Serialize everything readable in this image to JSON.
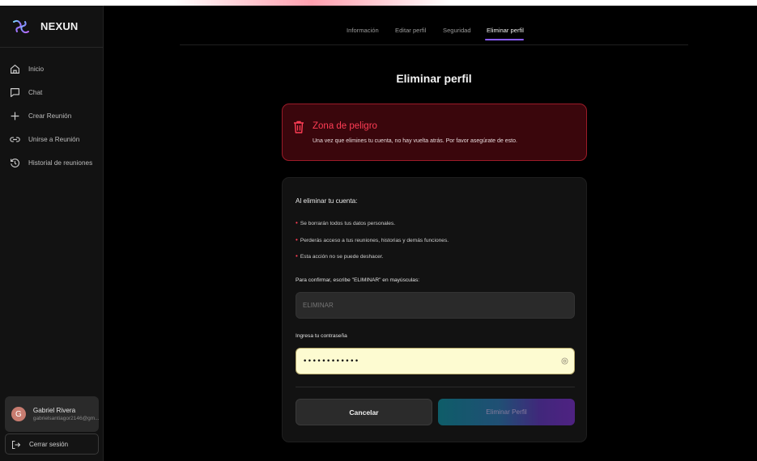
{
  "app": {
    "brand": "NEXUN"
  },
  "sidebar": {
    "items": [
      {
        "label": "Inicio",
        "icon": "home-icon"
      },
      {
        "label": "Chat",
        "icon": "chat-icon"
      },
      {
        "label": "Crear Reunión",
        "icon": "plus-icon"
      },
      {
        "label": "Unirse a Reunión",
        "icon": "link-icon"
      },
      {
        "label": "Historial de reuniones",
        "icon": "history-icon"
      }
    ]
  },
  "user": {
    "initial": "G",
    "name": "Gabriel Rivera",
    "email": "gabrielsantiagor2146@gm..."
  },
  "logout": {
    "label": "Cerrar sesión"
  },
  "tabs": [
    {
      "label": "Información"
    },
    {
      "label": "Editar perfil"
    },
    {
      "label": "Seguridad"
    },
    {
      "label": "Eliminar perfil",
      "active": true
    }
  ],
  "page": {
    "title": "Eliminar perfil"
  },
  "danger": {
    "title": "Zona de peligro",
    "text": "Una vez que elimines tu cuenta, no hay vuelta atrás. Por favor asegúrate de esto.",
    "color": "#ff3d55"
  },
  "form": {
    "heading": "Al eliminar tu cuenta:",
    "bullets": [
      "Se borrarán todos tus datos personales.",
      "Perderás acceso a tus reuniones, historias y demás funciones.",
      "Esta acción no se puede deshacer."
    ],
    "confirm_label": "Para confirmar, escribe \"ELIMINAR\" en mayúsculas:",
    "confirm_placeholder": "ELIMINAR",
    "confirm_value": "",
    "password_label": "Ingresa tu contraseña",
    "password_value": "••••••••••••",
    "cancel_label": "Cancelar",
    "delete_label": "Eliminar Perfil"
  },
  "colors": {
    "accent": "#8a5cff",
    "danger": "#ff3d55",
    "autofill": "#fdfbd1"
  }
}
